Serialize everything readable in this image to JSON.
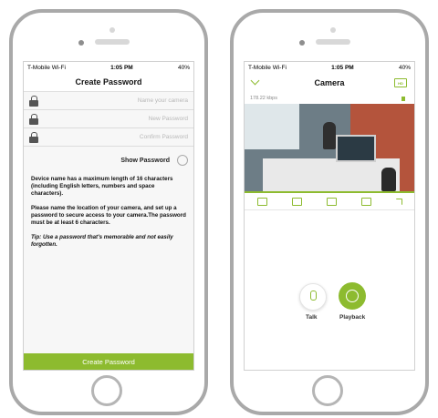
{
  "left": {
    "status": {
      "carrier": "T-Mobile Wi-Fi",
      "time": "1:05 PM",
      "battery": "40%"
    },
    "title": "Create Password",
    "fields": [
      {
        "placeholder": "Name your camera"
      },
      {
        "placeholder": "New Password"
      },
      {
        "placeholder": "Confirm Password"
      }
    ],
    "show_password": "Show Password",
    "info1": "Device name has a maximum length of 16 characters (including English letters, numbers and space characters).",
    "info2": "Please name the location of your camera, and set up a password to secure access to your camera.The password must be at least 6 characters.",
    "tip": "Tip: Use a password that's memorable and not easily forgotten.",
    "button": "Create Password"
  },
  "right": {
    "status": {
      "carrier": "T-Mobile Wi-Fi",
      "time": "1:05 PM",
      "battery": "40%"
    },
    "title": "Camera",
    "bitrate": "178.22 kbps",
    "hd_badge": "HD",
    "talk_label": "Talk",
    "playback_label": "Playback"
  },
  "colors": {
    "accent": "#8dbb2f"
  }
}
